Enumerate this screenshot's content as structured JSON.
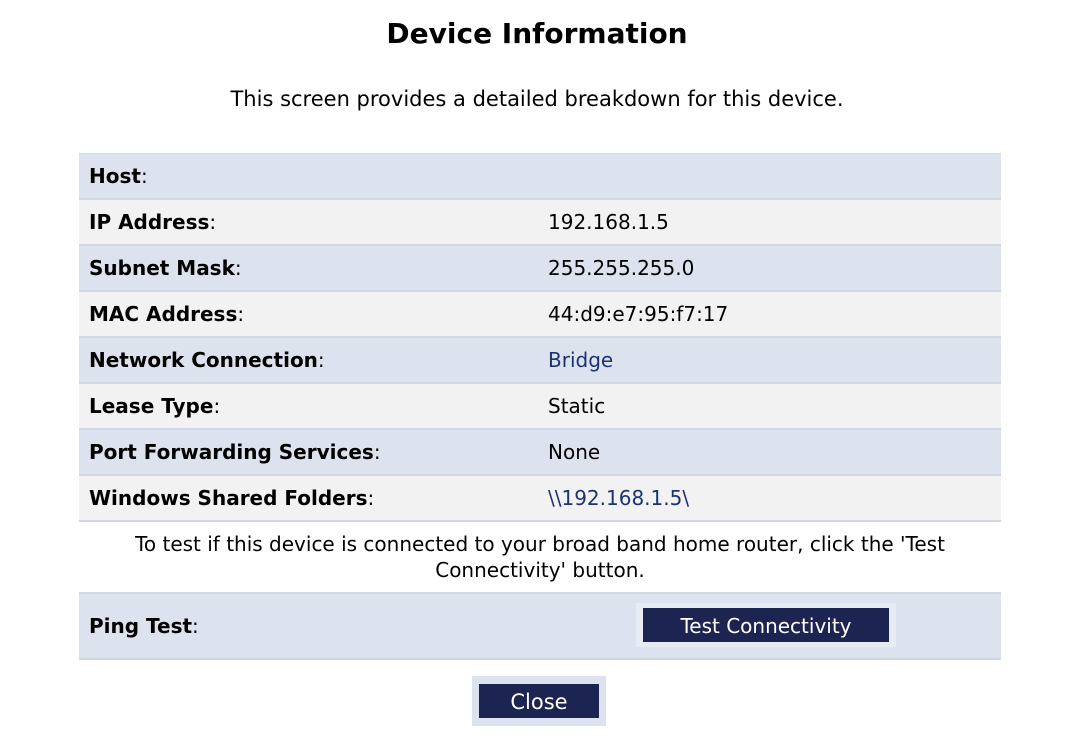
{
  "page": {
    "title": "Device Information",
    "description": "This screen provides a detailed breakdown for this device."
  },
  "rows": [
    {
      "label": "Host",
      "value": ""
    },
    {
      "label": "IP Address",
      "value": "192.168.1.5"
    },
    {
      "label": "Subnet Mask",
      "value": "255.255.255.0"
    },
    {
      "label": "MAC Address",
      "value": "44:d9:e7:95:f7:17"
    },
    {
      "label": "Network Connection",
      "value": "Bridge"
    },
    {
      "label": "Lease Type",
      "value": "Static"
    },
    {
      "label": "Port Forwarding Services",
      "value": "None"
    },
    {
      "label": "Windows Shared Folders",
      "value": "\\\\192.168.1.5\\"
    }
  ],
  "notice": "To test if this device is connected to your broad band home router, click the 'Test Connectivity' button.",
  "ping": {
    "label": "Ping Test",
    "button_label": "Test Connectivity"
  },
  "close_label": "Close",
  "colors": {
    "row_shade": "#dde3ee",
    "row_plain": "#f2f2f2",
    "button_bg": "#1c2451",
    "link": "#1c3272"
  }
}
